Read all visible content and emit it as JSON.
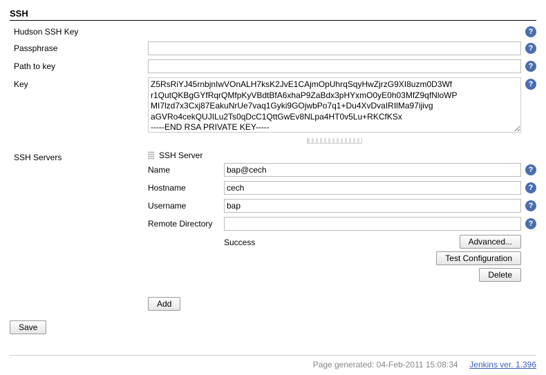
{
  "section_title": "SSH",
  "fields": {
    "hudson_ssh_key": "Hudson SSH Key",
    "passphrase": "Passphrase",
    "path_to_key": "Path to key",
    "key": "Key",
    "ssh_servers": "SSH Servers"
  },
  "values": {
    "passphrase": "",
    "path_to_key": "",
    "key": "Z5RsRiYJ45rnbjnIwVOnALH7ksK2JvE1CAjmOpUhrqSqyHwZjrzG9XI8uzm0D3Wf\nr1QutQKBgGYfRqrQMfpKyVBdtBfA6xhaP9ZaBdx3pHYxmO0yE0h03MfZ9qfNloWP\nMI7lzd7x3Cxj87EakuNrUe7vaq1Gyki9GOjwbPo7q1+Du4XvDvaIRIlMa97ijivg\naGVRo4cekQUJILu2Ts0qDcC1QttGwEv8NLpa4HT0v5Lu+RKCfKSx\n-----END RSA PRIVATE KEY-----"
  },
  "server": {
    "header": "SSH Server",
    "labels": {
      "name": "Name",
      "hostname": "Hostname",
      "username": "Username",
      "remote_dir": "Remote Directory"
    },
    "name": "bap@cech",
    "hostname": "cech",
    "username": "bap",
    "remote_dir": ""
  },
  "buttons": {
    "advanced": "Advanced...",
    "test": "Test Configuration",
    "delete": "Delete",
    "add": "Add",
    "save": "Save"
  },
  "status": "Success",
  "footer": {
    "generated": "Page generated: 04-Feb-2011 15:08:34",
    "version": "Jenkins ver. 1.396"
  }
}
